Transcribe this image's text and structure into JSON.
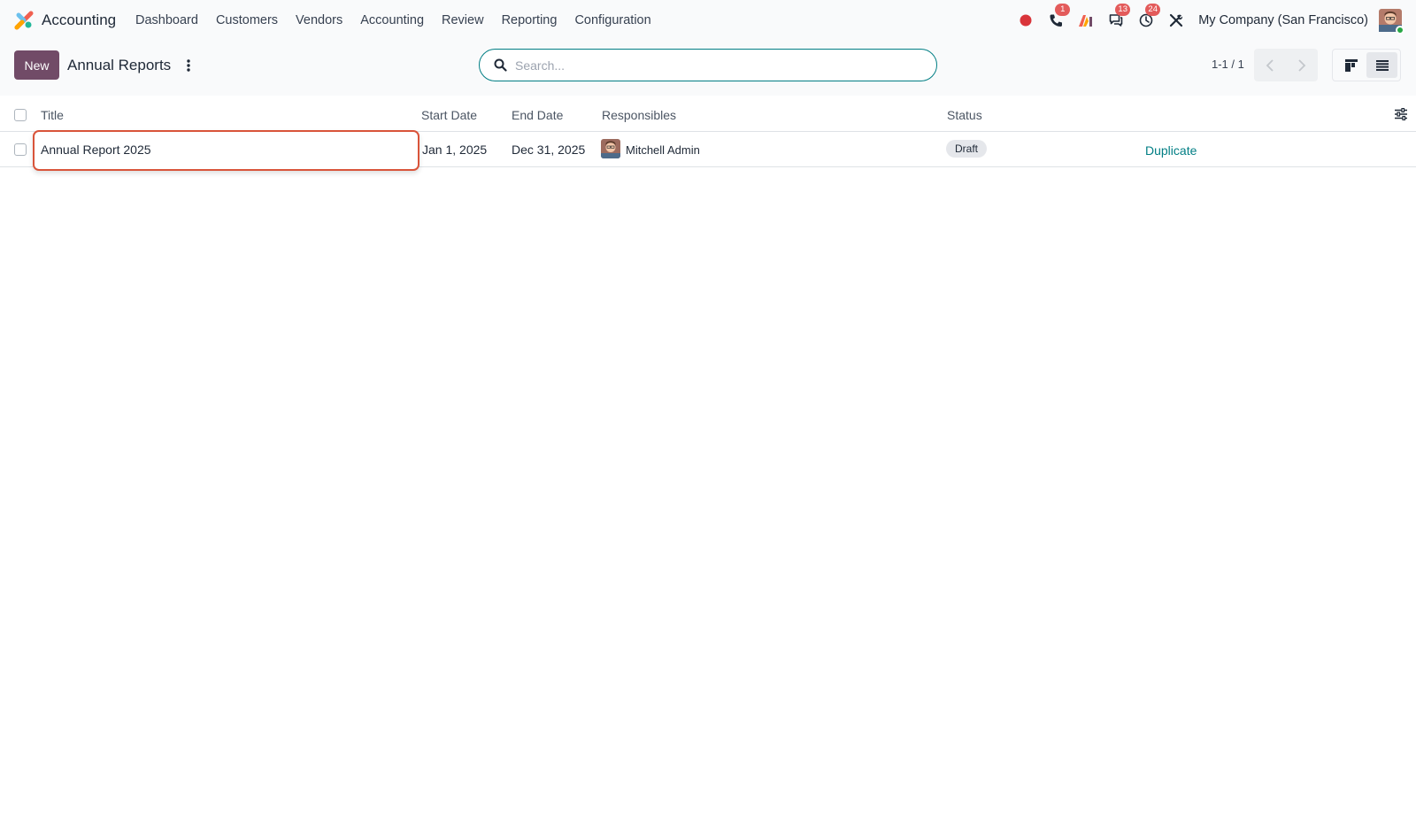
{
  "app": {
    "name": "Accounting"
  },
  "menu": [
    "Dashboard",
    "Customers",
    "Vendors",
    "Accounting",
    "Review",
    "Reporting",
    "Configuration"
  ],
  "systray": {
    "calls_badge": "1",
    "messages_badge": "13",
    "activities_badge": "24",
    "company": "My Company (San Francisco)"
  },
  "control_panel": {
    "new_label": "New",
    "title": "Annual Reports",
    "search_placeholder": "Search...",
    "pager": "1-1 / 1"
  },
  "table": {
    "columns": {
      "title": "Title",
      "start_date": "Start Date",
      "end_date": "End Date",
      "responsibles": "Responsibles",
      "status": "Status"
    },
    "rows": [
      {
        "title": "Annual Report 2025",
        "start_date": "Jan 1, 2025",
        "end_date": "Dec 31, 2025",
        "responsible": "Mitchell Admin",
        "status": "Draft",
        "action": "Duplicate"
      }
    ]
  },
  "colors": {
    "brand": "#714b67",
    "accent": "#017e84",
    "highlight_border": "#d9543a",
    "badge": "#e35b5b"
  }
}
